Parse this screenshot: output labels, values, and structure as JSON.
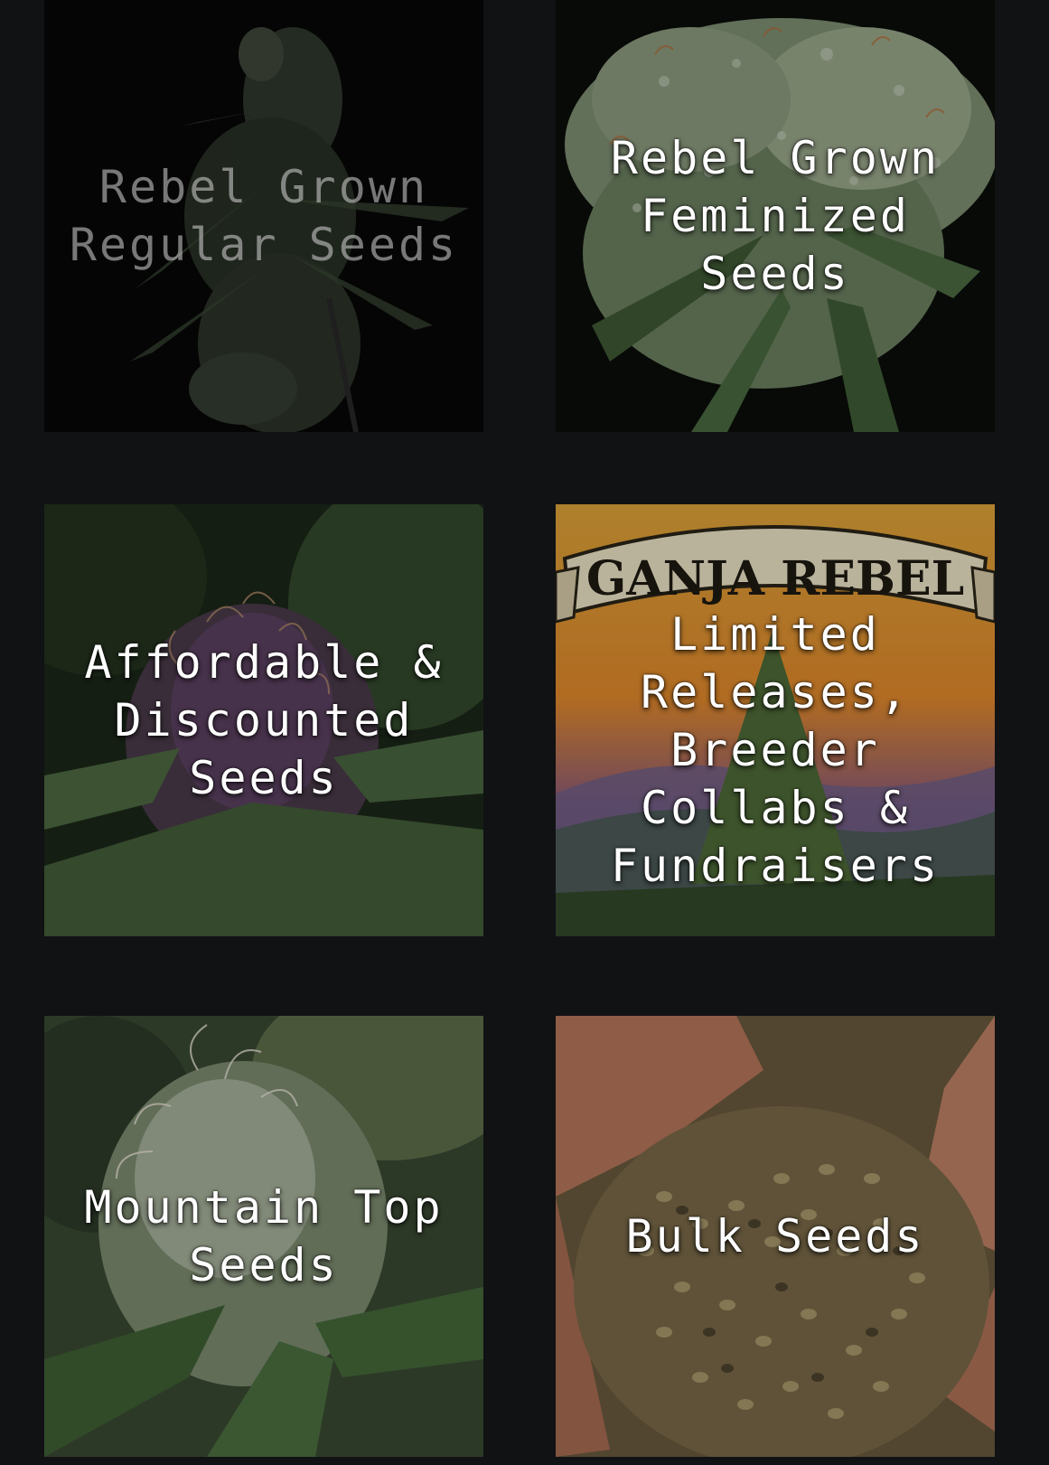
{
  "tiles": [
    {
      "id": "regular",
      "lines": [
        "Rebel Grown",
        "Regular Seeds"
      ]
    },
    {
      "id": "feminized",
      "lines": [
        "Rebel Grown",
        "Feminized",
        "Seeds"
      ]
    },
    {
      "id": "affordable",
      "lines": [
        "Affordable &",
        "Discounted",
        "Seeds"
      ]
    },
    {
      "id": "limited",
      "lines": [
        "Limited",
        "Releases,",
        "Breeder",
        "Collabs &",
        "Fundraisers"
      ],
      "banner": "GANJA REBEL"
    },
    {
      "id": "mountain",
      "lines": [
        "Mountain Top",
        "Seeds"
      ]
    },
    {
      "id": "bulk",
      "lines": [
        "Bulk Seeds"
      ]
    }
  ],
  "colors": {
    "background": "#111214",
    "label": "#ffffff"
  }
}
